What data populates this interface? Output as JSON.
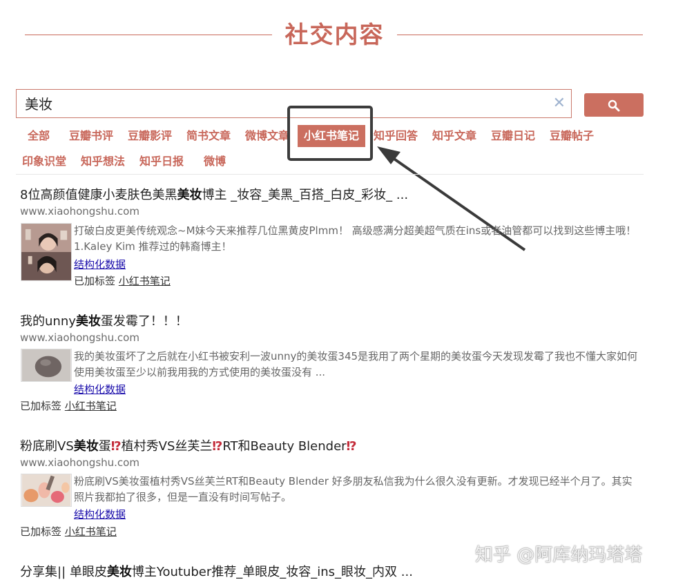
{
  "header": {
    "title": "社交内容"
  },
  "search": {
    "value": "美妆",
    "clear_icon": "close-icon",
    "button_icon": "search-icon"
  },
  "tabs": {
    "row1": [
      "全部",
      "豆瓣书评",
      "豆瓣影评",
      "简书文章",
      "微博文章",
      "小红书笔记",
      "知乎回答",
      "知乎文章",
      "豆瓣日记",
      "豆瓣帖子"
    ],
    "row2": [
      "印象识堂",
      "知乎想法",
      "知乎日报",
      "微博"
    ],
    "active": "小红书笔记"
  },
  "results": [
    {
      "title_pre": "8位高颜值健康小麦肤色美黑",
      "title_kw": "美妆",
      "title_post": "博主 _妆容_美黑_百搭_白皮_彩妆_ ...",
      "url": "www.xiaohongshu.com",
      "snippet": "打破白皮更美传统观念~M妹今天来推荐几位黑黄皮Plmm！ 高级感满分超美超气质在ins或者油管都可以找到这些博主哦！ 1.Kaley Kim 推荐过的韩裔博主！",
      "structured_label": "结构化数据",
      "tag_prefix": "已加标签",
      "tag": "小红书笔记"
    },
    {
      "title_pre": "我的unny",
      "title_kw": "美妆",
      "title_post": "蛋发霉了！！！",
      "url": "www.xiaohongshu.com",
      "snippet": "我的美妆蛋坏了之后就在小红书被安利一波unny的美妆蛋345是我用了两个星期的美妆蛋今天发现发霉了我也不懂大家如何使用美妆蛋至少以前我用我的方式使用的美妆蛋没有 ...",
      "structured_label": "结构化数据",
      "tag_prefix": "已加标签",
      "tag": "小红书笔记"
    },
    {
      "title_pre": "粉底刷VS",
      "title_kw": "美妆",
      "title_post": "蛋",
      "title_warn1": "⁉",
      "title_mid": "植村秀VS丝芙兰",
      "title_warn2": "⁉",
      "title_end": "RT和Beauty Blender",
      "title_warn3": "⁉",
      "url": "www.xiaohongshu.com",
      "snippet": "粉底刷VS美妆蛋植村秀VS丝芙兰RT和Beauty Blender 好多朋友私信我为什么很久没有更新。才发现已经半个月了。其实照片我都拍了很多，但是一直没有时间写帖子。",
      "structured_label": "结构化数据",
      "tag_prefix": "已加标签",
      "tag": "小红书笔记"
    },
    {
      "title_pre": "分享集|| 单眼皮",
      "title_kw": "美妆",
      "title_post": "博主Youtuber推荐_单眼皮_妆容_ins_眼妆_内双 ..."
    }
  ],
  "watermark": "知乎 @阿库纳玛塔塔",
  "colors": {
    "accent": "#cb6f60",
    "link": "#1a0dab"
  }
}
